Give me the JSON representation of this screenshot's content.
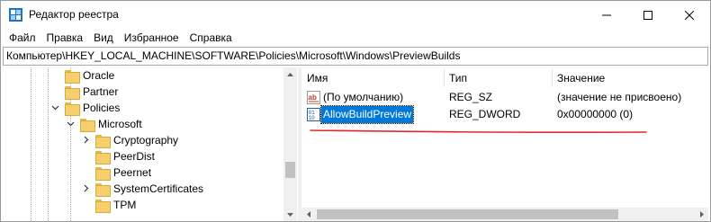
{
  "window": {
    "title": "Редактор реестра",
    "controls": {
      "minimize_icon": "minimize-icon",
      "maximize_icon": "maximize-icon",
      "close_icon": "close-icon"
    }
  },
  "menu": {
    "items": [
      {
        "label": "Файл"
      },
      {
        "label": "Правка"
      },
      {
        "label": "Вид"
      },
      {
        "label": "Избранное"
      },
      {
        "label": "Справка"
      }
    ]
  },
  "address": {
    "path": "Компьютер\\HKEY_LOCAL_MACHINE\\SOFTWARE\\Policies\\Microsoft\\Windows\\PreviewBuilds"
  },
  "tree": {
    "items": [
      {
        "label": "Oracle",
        "expander": ""
      },
      {
        "label": "Partner",
        "expander": ""
      },
      {
        "label": "Policies",
        "expander": "expanded"
      },
      {
        "label": "Microsoft",
        "expander": "expanded"
      },
      {
        "label": "Cryptography",
        "expander": "collapsed"
      },
      {
        "label": "PeerDist",
        "expander": ""
      },
      {
        "label": "Peernet",
        "expander": ""
      },
      {
        "label": "SystemCertificates",
        "expander": "collapsed"
      },
      {
        "label": "TPM",
        "expander": ""
      }
    ]
  },
  "values": {
    "columns": {
      "name": "Имя",
      "type": "Тип",
      "data": "Значение"
    },
    "rows": [
      {
        "name": "(По умолчанию)",
        "type": "REG_SZ",
        "data": "(значение не присвоено)",
        "icon": "string-value-icon"
      },
      {
        "name": "AllowBuildPreview",
        "type": "REG_DWORD",
        "data": "0x00000000 (0)",
        "icon": "binary-value-icon",
        "selected": true
      }
    ]
  },
  "colors": {
    "selection": "#0078d7",
    "annotation": "#e8262b",
    "folder": "#f4cf6b"
  }
}
